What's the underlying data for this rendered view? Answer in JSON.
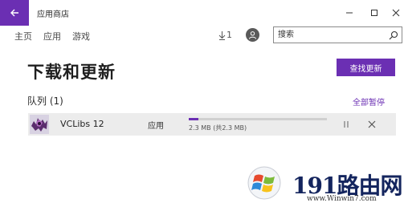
{
  "window": {
    "title": "应用商店"
  },
  "nav": {
    "home": "主页",
    "apps": "应用",
    "games": "游戏"
  },
  "header": {
    "download_count": "1"
  },
  "search": {
    "placeholder": "搜索"
  },
  "main": {
    "title": "下载和更新",
    "check_updates_label": "查找更新",
    "queue_heading": "队列 (1)",
    "pause_all_label": "全部暂停",
    "downloads": [
      {
        "name": "VCLibs 12",
        "type": "应用",
        "size_text": "2.3 MB (共2.3 MB)",
        "progress": 0.07
      }
    ]
  },
  "watermark": {
    "brand": "191路由网",
    "url": "www.Winwin7.com"
  },
  "colors": {
    "accent": "#6b2fb3",
    "row_bg": "#ececec"
  },
  "icons": [
    "back-arrow-icon",
    "minimize-icon",
    "maximize-icon",
    "close-icon",
    "download-icon",
    "user-icon",
    "search-icon",
    "pause-icon",
    "cancel-icon"
  ]
}
